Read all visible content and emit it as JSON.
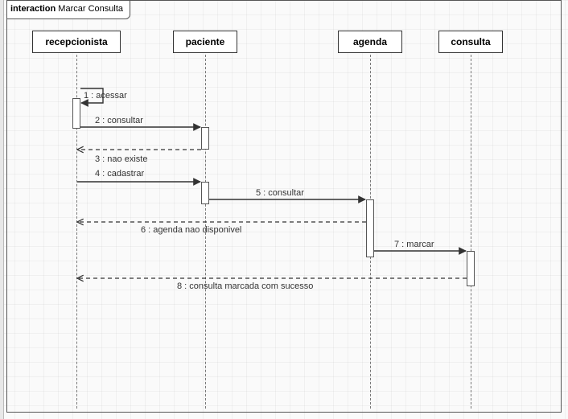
{
  "frame": {
    "keyword": "interaction",
    "title": "Marcar Consulta"
  },
  "lifelines": {
    "recepcionista": {
      "label": "recepcionista"
    },
    "paciente": {
      "label": "paciente"
    },
    "agenda": {
      "label": "agenda"
    },
    "consulta": {
      "label": "consulta"
    }
  },
  "messages": {
    "m1": {
      "label": "1 : acessar"
    },
    "m2": {
      "label": "2 : consultar"
    },
    "m3": {
      "label": "3 : nao existe"
    },
    "m4": {
      "label": "4 : cadastrar"
    },
    "m5": {
      "label": "5 : consultar"
    },
    "m6": {
      "label": "6 : agenda nao disponivel"
    },
    "m7": {
      "label": "7 : marcar"
    },
    "m8": {
      "label": "8 : consulta marcada com sucesso"
    }
  },
  "chart_data": {
    "type": "uml-sequence-diagram",
    "frame": {
      "keyword": "interaction",
      "name": "Marcar Consulta"
    },
    "lifelines": [
      "recepcionista",
      "paciente",
      "agenda",
      "consulta"
    ],
    "messages": [
      {
        "n": 1,
        "from": "recepcionista",
        "to": "recepcionista",
        "label": "acessar",
        "kind": "sync",
        "self": true
      },
      {
        "n": 2,
        "from": "recepcionista",
        "to": "paciente",
        "label": "consultar",
        "kind": "sync"
      },
      {
        "n": 3,
        "from": "paciente",
        "to": "recepcionista",
        "label": "nao existe",
        "kind": "return"
      },
      {
        "n": 4,
        "from": "recepcionista",
        "to": "paciente",
        "label": "cadastrar",
        "kind": "sync"
      },
      {
        "n": 5,
        "from": "paciente",
        "to": "agenda",
        "label": "consultar",
        "kind": "sync"
      },
      {
        "n": 6,
        "from": "agenda",
        "to": "recepcionista",
        "label": "agenda nao disponivel",
        "kind": "return"
      },
      {
        "n": 7,
        "from": "agenda",
        "to": "consulta",
        "label": "marcar",
        "kind": "sync"
      },
      {
        "n": 8,
        "from": "consulta",
        "to": "recepcionista",
        "label": "consulta marcada com sucesso",
        "kind": "return"
      }
    ]
  }
}
